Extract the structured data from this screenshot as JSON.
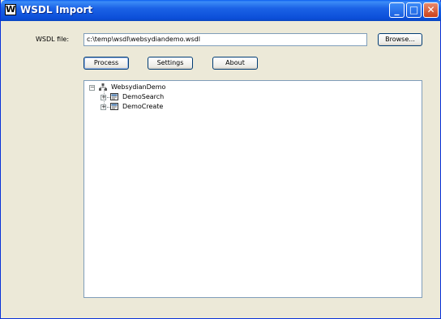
{
  "window": {
    "title": "WSDL Import",
    "app_icon_glyph": "W",
    "controls": {
      "minimize": "_",
      "maximize": "□",
      "close": "✕"
    }
  },
  "form": {
    "wsdl_label": "WSDL file:",
    "wsdl_value": "c:\\temp\\wsdl\\websydiandemo.wsdl",
    "browse_label": "Browse..."
  },
  "toolbar": {
    "process_label": "Process",
    "settings_label": "Settings",
    "about_label": "About"
  },
  "tree": {
    "root": {
      "label": "WebsydianDemo",
      "expander": "−",
      "icon": "hierarchy-icon"
    },
    "children": [
      {
        "label": "DemoSearch",
        "expander": "+",
        "icon": "class-icon"
      },
      {
        "label": "DemoCreate",
        "expander": "+",
        "icon": "class-icon"
      }
    ]
  },
  "colors": {
    "titlebar": "#0b4ed8",
    "window_bg": "#ece9d8",
    "border": "#7f9db9"
  }
}
